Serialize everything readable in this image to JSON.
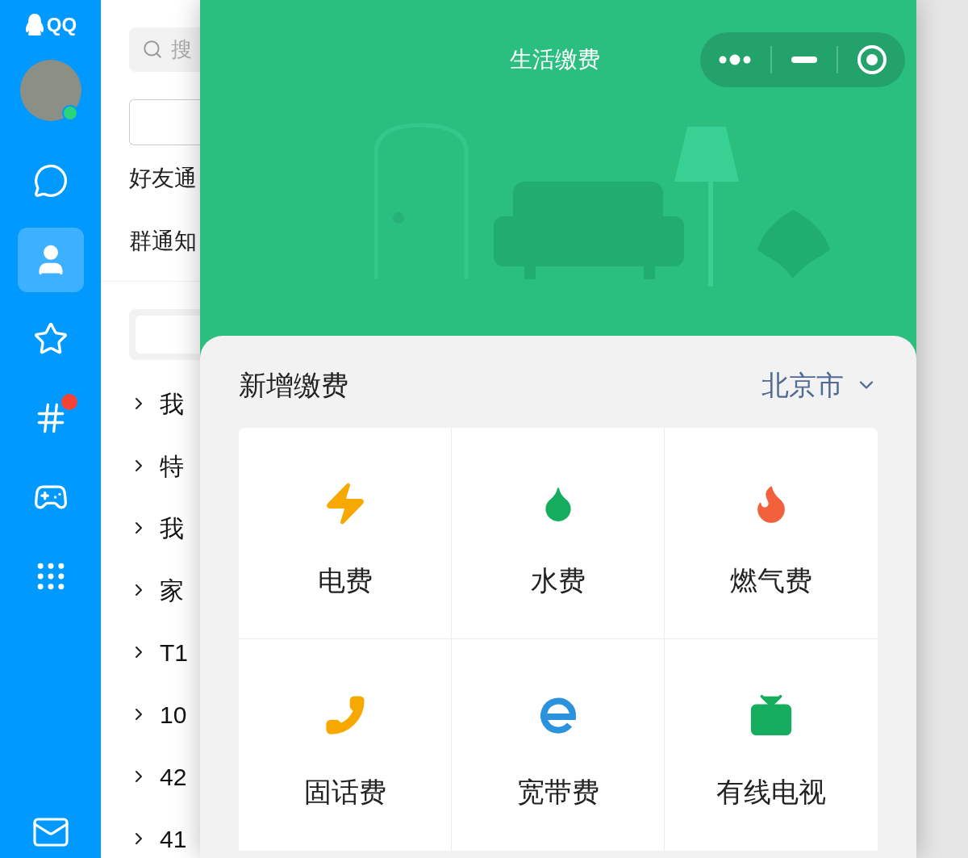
{
  "app_logo": {
    "text": "QQ"
  },
  "sidebar": {
    "items": [
      {
        "kind": "chat",
        "selected": false,
        "badge": false
      },
      {
        "kind": "contacts",
        "selected": true,
        "badge": false
      },
      {
        "kind": "star",
        "selected": false,
        "badge": false
      },
      {
        "kind": "hash",
        "selected": false,
        "badge": true
      },
      {
        "kind": "game",
        "selected": false,
        "badge": false
      },
      {
        "kind": "apps",
        "selected": false,
        "badge": false
      }
    ],
    "bottom": {
      "kind": "mail"
    }
  },
  "contacts_panel": {
    "search": {
      "placeholder": "搜"
    },
    "notices": [
      "好友通",
      "群通知"
    ],
    "groups": [
      {
        "label": "我",
        "expanded": false
      },
      {
        "label": "特",
        "expanded": false
      },
      {
        "label": "我",
        "expanded": false
      },
      {
        "label": "家",
        "expanded": false
      },
      {
        "label": "T1",
        "expanded": false
      },
      {
        "label": "10",
        "expanded": false
      },
      {
        "label": "42",
        "expanded": false
      },
      {
        "label": "41",
        "expanded": false
      }
    ]
  },
  "mini_program": {
    "title": "生活缴费",
    "section": {
      "title": "新增缴费",
      "city": "北京市"
    },
    "services": [
      {
        "kind": "electricity",
        "label": "电费",
        "color": "#f7a900"
      },
      {
        "kind": "water",
        "label": "水费",
        "color": "#17ad5e"
      },
      {
        "kind": "gas",
        "label": "燃气费",
        "color": "#f2613c"
      },
      {
        "kind": "phone",
        "label": "固话费",
        "color": "#f7a900"
      },
      {
        "kind": "broadband",
        "label": "宽带费",
        "color": "#2b92de"
      },
      {
        "kind": "tv",
        "label": "有线电视",
        "color": "#17ad5e"
      }
    ]
  }
}
